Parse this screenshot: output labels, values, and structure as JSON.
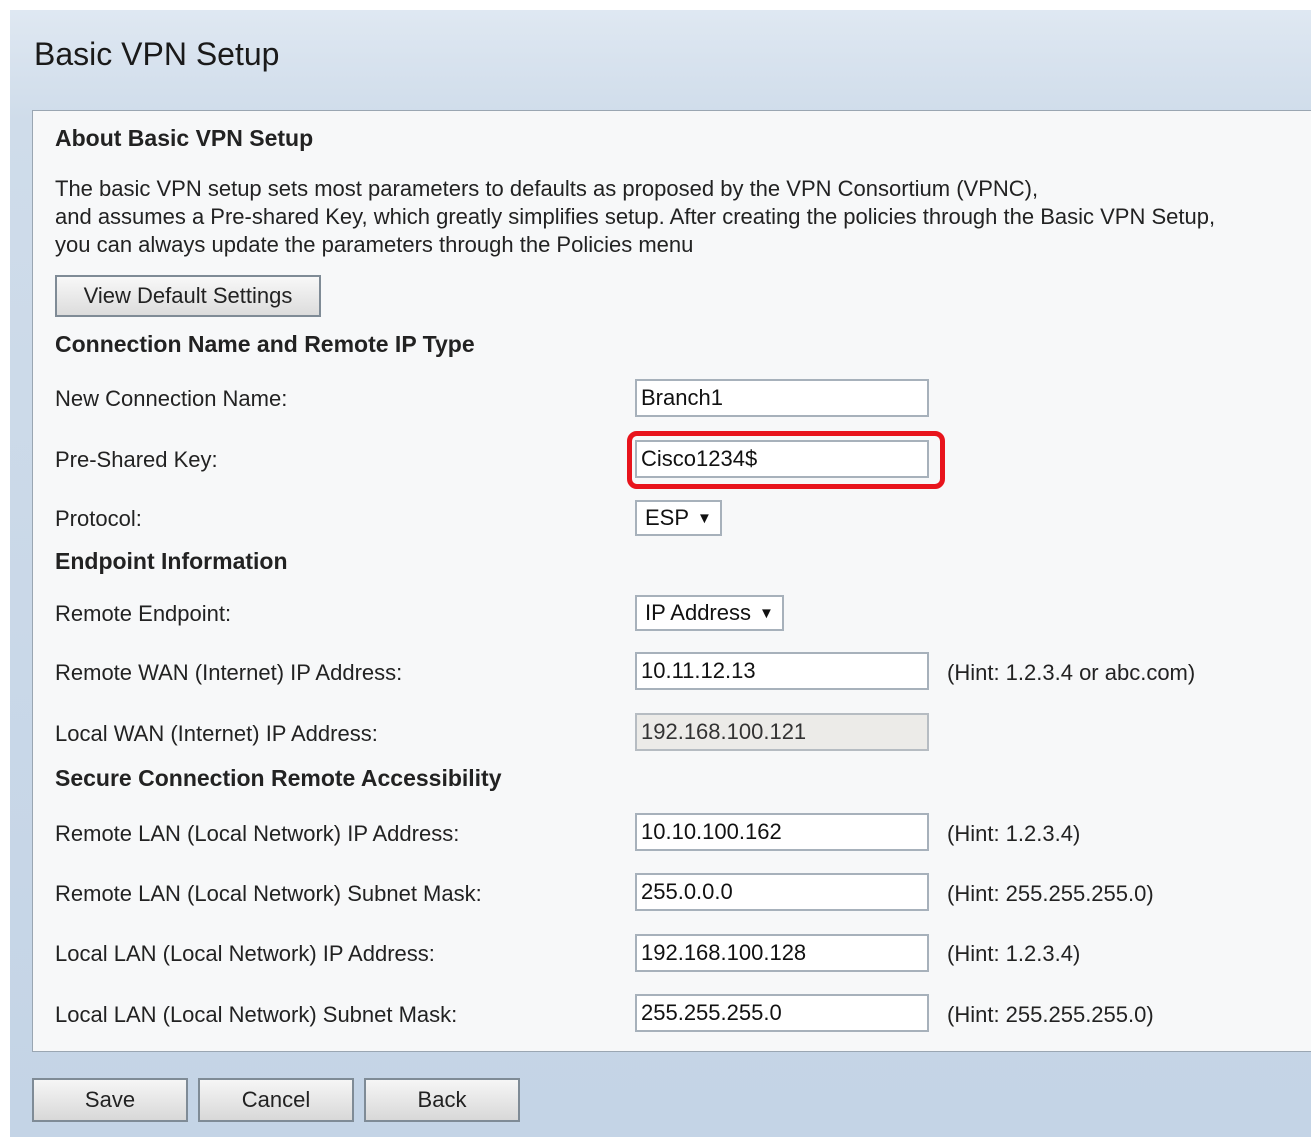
{
  "page": {
    "title": "Basic VPN Setup"
  },
  "about": {
    "heading": "About Basic VPN Setup",
    "lines": [
      "The basic VPN setup sets most parameters to defaults as proposed by the VPN Consortium (VPNC),",
      "and assumes a Pre-shared Key, which greatly simplifies setup. After creating the policies through the Basic VPN Setup,",
      "you can always update the parameters through the Policies menu"
    ],
    "view_default_button": "View Default Settings"
  },
  "connection": {
    "heading": "Connection Name and Remote IP Type",
    "name_label": "New Connection Name:",
    "name_value": "Branch1",
    "psk_label": "Pre-Shared Key:",
    "psk_value": "Cisco1234$",
    "protocol_label": "Protocol:",
    "protocol_value": "ESP"
  },
  "endpoint": {
    "heading": "Endpoint Information",
    "remote_endpoint_label": "Remote Endpoint:",
    "remote_endpoint_value": "IP Address",
    "remote_wan_label": "Remote WAN (Internet) IP Address:",
    "remote_wan_value": "10.11.12.13",
    "remote_wan_hint": "(Hint: 1.2.3.4 or abc.com)",
    "local_wan_label": "Local WAN (Internet) IP Address:",
    "local_wan_value": "192.168.100.121"
  },
  "accessibility": {
    "heading": "Secure Connection Remote Accessibility",
    "remote_lan_ip_label": "Remote LAN (Local Network) IP Address:",
    "remote_lan_ip_value": "10.10.100.162",
    "remote_lan_ip_hint": "(Hint: 1.2.3.4)",
    "remote_lan_mask_label": "Remote LAN (Local Network) Subnet Mask:",
    "remote_lan_mask_value": "255.0.0.0",
    "remote_lan_mask_hint": "(Hint: 255.255.255.0)",
    "local_lan_ip_label": "Local LAN (Local Network) IP Address:",
    "local_lan_ip_value": "192.168.100.128",
    "local_lan_ip_hint": "(Hint: 1.2.3.4)",
    "local_lan_mask_label": "Local LAN (Local Network) Subnet Mask:",
    "local_lan_mask_value": "255.255.255.0",
    "local_lan_mask_hint": "(Hint: 255.255.255.0)"
  },
  "actions": {
    "save": "Save",
    "cancel": "Cancel",
    "back": "Back"
  },
  "colors": {
    "highlight": "#e8141c",
    "background_top": "#dfe8f2",
    "background_bottom": "#c4d4e6"
  },
  "icons": {
    "dropdown": "triangle-down-icon"
  }
}
